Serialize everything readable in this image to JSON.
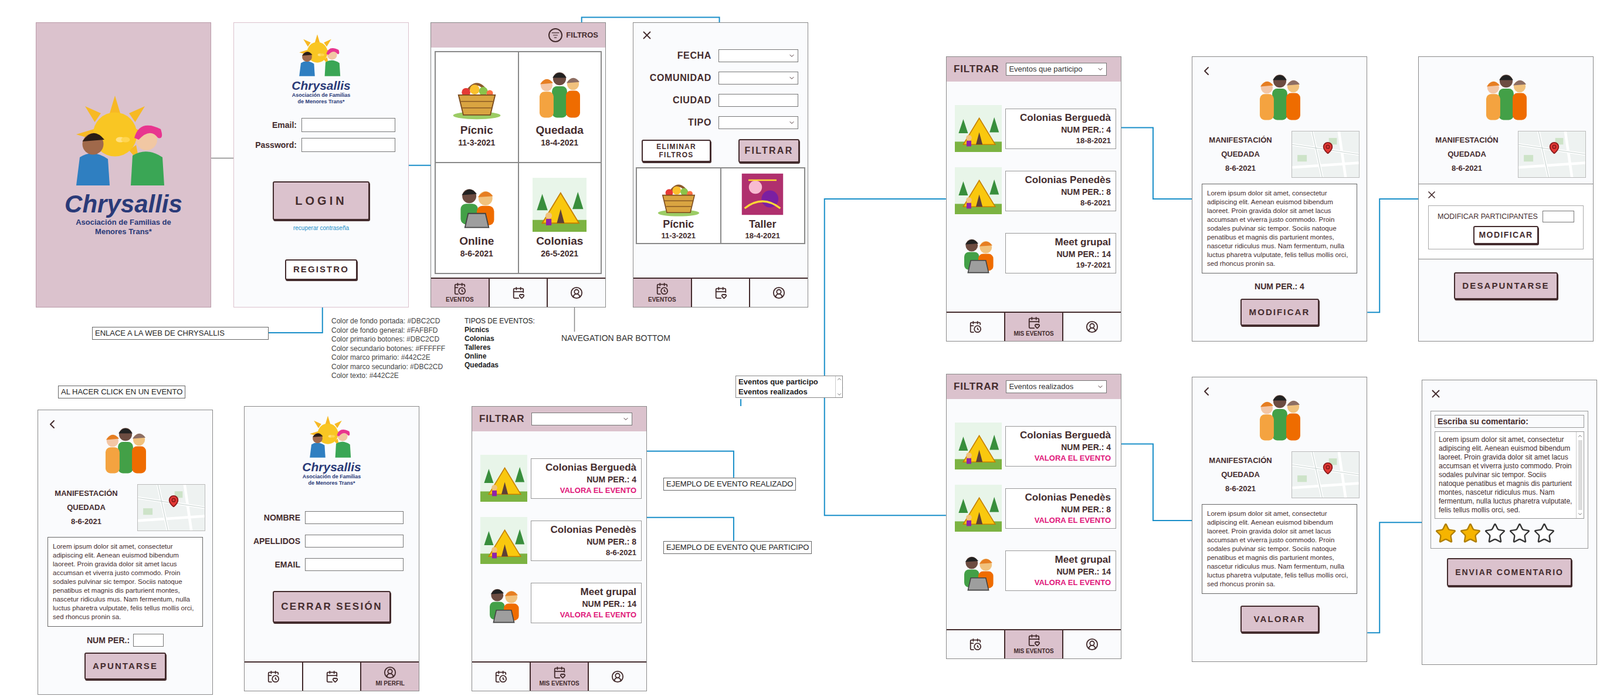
{
  "logo": {
    "name": "Chrysallis",
    "subtitle": "Asociación de Familias de Menores Trans*"
  },
  "event_description": "Lorem ipsum dolor sit amet, consectetur adipiscing elit. Aenean euismod bibendum laoreet. Proin gravida dolor sit amet lacus accumsan et viverra justo commodo. Proin sodales pulvinar sic tempor. Sociis natoque penatibus et magnis dis parturient montes, nascetur ridiculus mus. Nam fermentum, nulla luctus pharetra vulputate, felis tellus mollis orci, sed rhoncus pronin sa.",
  "login": {
    "fields": [
      {
        "label": "Email:",
        "value": ""
      },
      {
        "label": "Password:",
        "value": ""
      }
    ],
    "login_button": "LOGIN",
    "recover_link": "recuperar contraseña",
    "register_button": "REGISTRO"
  },
  "events": {
    "filter_button": "FILTROS",
    "cards": [
      {
        "title": "Pícnic",
        "date": "11-3-2021"
      },
      {
        "title": "Quedada",
        "date": "18-4-2021"
      },
      {
        "title": "Online",
        "date": "8-6-2021"
      },
      {
        "title": "Colonias",
        "date": "26-5-2021"
      }
    ],
    "nav": [
      {
        "label": "EVENTOS",
        "selected": true
      },
      {
        "label": "",
        "selected": false
      },
      {
        "label": "",
        "selected": false
      }
    ]
  },
  "filters": {
    "fields": [
      {
        "label": "FECHA",
        "kind": "select",
        "value": ""
      },
      {
        "label": "COMUNIDAD",
        "kind": "select",
        "value": ""
      },
      {
        "label": "CIUDAD",
        "kind": "input",
        "value": ""
      },
      {
        "label": "TIPO",
        "kind": "select",
        "value": ""
      }
    ],
    "clear_button": "ELIMINAR FILTROS",
    "apply_button": "FILTRAR",
    "cards": [
      {
        "title": "Pícnic",
        "date": "11-3-2021"
      },
      {
        "title": "Taller",
        "date": "18-4-2021"
      }
    ],
    "nav": [
      {
        "label": "EVENTOS",
        "selected": true
      },
      {
        "label": "",
        "selected": false
      },
      {
        "label": "",
        "selected": false
      }
    ]
  },
  "participating": {
    "filter_label": "FILTRAR",
    "dropdown": "Eventos que participo",
    "cards": [
      {
        "title": "Colonias Berguedà",
        "people": "NUM PER.: 4",
        "status": "18-8-2021",
        "kind": "date"
      },
      {
        "title": "Colonias Penedès",
        "people": "NUM PER.: 8",
        "status": "8-6-2021",
        "kind": "date"
      },
      {
        "title": "Meet grupal",
        "people": "NUM PER.: 14",
        "status": "19-7-2021",
        "kind": "date"
      }
    ],
    "nav": [
      {
        "label": "",
        "selected": false
      },
      {
        "label": "MIS EVENTOS",
        "selected": true
      },
      {
        "label": "",
        "selected": false
      }
    ]
  },
  "completed": {
    "filter_label": "FILTRAR",
    "dropdown": "Eventos realizados",
    "cards": [
      {
        "title": "Colonias Berguedà",
        "people": "NUM PER.: 4",
        "status": "VALORA EL EVENTO",
        "kind": "rate"
      },
      {
        "title": "Colonias Penedès",
        "people": "NUM PER.: 8",
        "status": "VALORA EL EVENTO",
        "kind": "rate"
      },
      {
        "title": "Meet grupal",
        "people": "NUM PER.: 14",
        "status": "VALORA EL EVENTO",
        "kind": "rate"
      }
    ],
    "nav": [
      {
        "label": "",
        "selected": false
      },
      {
        "label": "MIS EVENTOS",
        "selected": true
      },
      {
        "label": "",
        "selected": false
      }
    ]
  },
  "my_events": {
    "filter_label": "FILTRAR",
    "dropdown": "",
    "cards": [
      {
        "title": "Colonias Berguedà",
        "people": "NUM PER.: 4",
        "status": "VALORA EL EVENTO",
        "kind": "rate"
      },
      {
        "title": "Colonias Penedès",
        "people": "NUM PER.: 8",
        "status": "8-6-2021",
        "kind": "date"
      },
      {
        "title": "Meet grupal",
        "people": "NUM PER.: 14",
        "status": "VALORA EL EVENTO",
        "kind": "rate"
      }
    ],
    "nav": [
      {
        "label": "",
        "selected": false
      },
      {
        "label": "MIS EVENTOS",
        "selected": true
      },
      {
        "label": "",
        "selected": false
      }
    ]
  },
  "dropdown_options": [
    {
      "label": "Eventos que participo"
    },
    {
      "label": "Eventos realizados"
    }
  ],
  "event_detail": {
    "title": "MANIFESTACIÓN QUEDADA",
    "date": "8-6-2021",
    "people_label": "NUM PER.:",
    "people_value": "",
    "button": "APUNTARSE"
  },
  "modify_detail": {
    "title": "MANIFESTACIÓN QUEDADA",
    "date": "8-6-2021",
    "people": "NUM PER.: 4",
    "button": "MODIFICAR"
  },
  "unsubscribe": {
    "title": "MANIFESTACIÓN QUEDADA",
    "date": "8-6-2021",
    "dialog": {
      "label": "MODIFICAR PARTICIPANTES",
      "value": "",
      "button": "MODIFICAR"
    },
    "button": "DESAPUNTARSE"
  },
  "rate_detail": {
    "title": "MANIFESTACIÓN QUEDADA",
    "date": "8-6-2021",
    "button": "VALORAR"
  },
  "comment": {
    "heading": "Escriba su comentario:",
    "text": "Lorem ipsum dolor sit amet, consectetur adipiscing elit. Aenean euismod bibendum laoreet. Proin gravida dolor sit amet lacus accumsan et viverra justo commodo. Proin sodales pulvinar sic tempor. Sociis natoque penatibus et magnis dis parturient montes, nascetur ridiculus mus. Nam fermentum, nulla luctus pharetra vulputate, felis tellus mollis orci, sed.",
    "stars": 2,
    "out_of": 5,
    "button": "ENVIAR COMENTARIO"
  },
  "profile": {
    "fields": [
      {
        "label": "NOMBRE",
        "value": ""
      },
      {
        "label": "APELLIDOS",
        "value": ""
      },
      {
        "label": "EMAIL",
        "value": ""
      }
    ],
    "button": "CERRAR SESIÓN",
    "nav": [
      {
        "label": "",
        "selected": false
      },
      {
        "label": "",
        "selected": false
      },
      {
        "label": "MI PERFIL",
        "selected": true
      }
    ]
  },
  "notes": {
    "link": "ENLACE A LA WEB DE CHRYSALLIS",
    "on_click": "AL HACER CLICK EN UN EVENTO",
    "colors": [
      "Color de fondo portada: #DBC2CD",
      "Color de fondo general: #FAFBFD",
      "Color primario botones: #DBC2CD",
      "Color secundario botones: #FFFFFF",
      "Color marco primario: #442C2E",
      "Color marco secundario: #DBC2CD",
      "Color texto: #442C2E"
    ],
    "types_title": "TIPOS DE EVENTOS:",
    "types": [
      "Picnics",
      "Colonias",
      "Talleres",
      "Online",
      "Quedadas"
    ],
    "nav_note": "NAVEGATION BAR BOTTOM",
    "example_done": "EJEMPLO DE EVENTO REALIZADO",
    "example_joined": "EJEMPLO DE EVENTO QUE PARTICIPO"
  }
}
